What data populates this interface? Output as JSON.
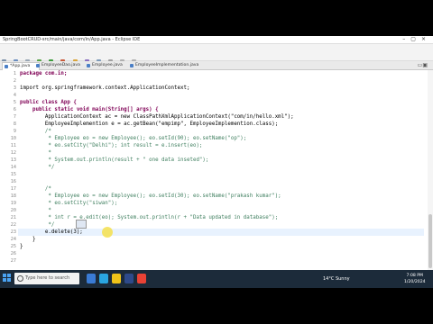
{
  "window": {
    "title": "SpringBootCRUD-src/main/java/com/in/App.java - Eclipse IDE"
  },
  "menu": [
    "File",
    "Edit",
    "Source",
    "Refactor",
    "Navigate",
    "Search",
    "Project",
    "Run",
    "Window",
    "Help"
  ],
  "tabs": [
    {
      "label": "*App.java",
      "active": true
    },
    {
      "label": "EmployeeDao.java",
      "active": false
    },
    {
      "label": "Employee.java",
      "active": false
    },
    {
      "label": "EmployeeImplementation.java",
      "active": false
    }
  ],
  "editor": {
    "line_numbers": [
      "1",
      "2",
      "3",
      "4",
      "5",
      "6",
      "7",
      "8",
      "9",
      "10",
      "11",
      "12",
      "13",
      "14",
      "15",
      "16",
      "17",
      "18",
      "19",
      "20",
      "21",
      "22",
      "23",
      "24",
      "25",
      "26",
      "27"
    ],
    "lines": [
      "package com.in;",
      "",
      "import org.springframework.context.ApplicationContext;",
      "",
      "public class App {",
      "    public static void main(String[] args) {",
      "        ApplicationContext ac = new ClassPathXmlApplicationContext(\"com/in/hello.xml\");",
      "        EmployeeImplemention e = ac.getBean(\"empimp\", EmployeeImplemention.class);",
      "        /*",
      "         * Employee eo = new Employee(); eo.setId(90); eo.setName(\"op\");",
      "         * eo.setCity(\"Delhi\"); int result = e.insert(eo);",
      "         *",
      "         * System.out.println(result + \" one data inseted\");",
      "         */",
      "",
      "",
      "        /*",
      "         * Employee eo = new Employee(); eo.setId(30); eo.setName(\"prakash kumar\");",
      "         * eo.setCity(\"siwan\");",
      "         *",
      "         * int r = e.edit(eo); System.out.println(r + \"Data updated in database\");",
      "         */",
      "        e.delete(3);",
      "    }",
      "}",
      "",
      ""
    ]
  },
  "statusbar": {
    "mode": "Writable",
    "insert": "Smart Insert",
    "position": "23 : 20 : 515"
  },
  "taskbar": {
    "search_placeholder": "Type here to search",
    "weather": "14°C Sunny",
    "time": "7:08 PM",
    "date": "1/20/2024"
  }
}
